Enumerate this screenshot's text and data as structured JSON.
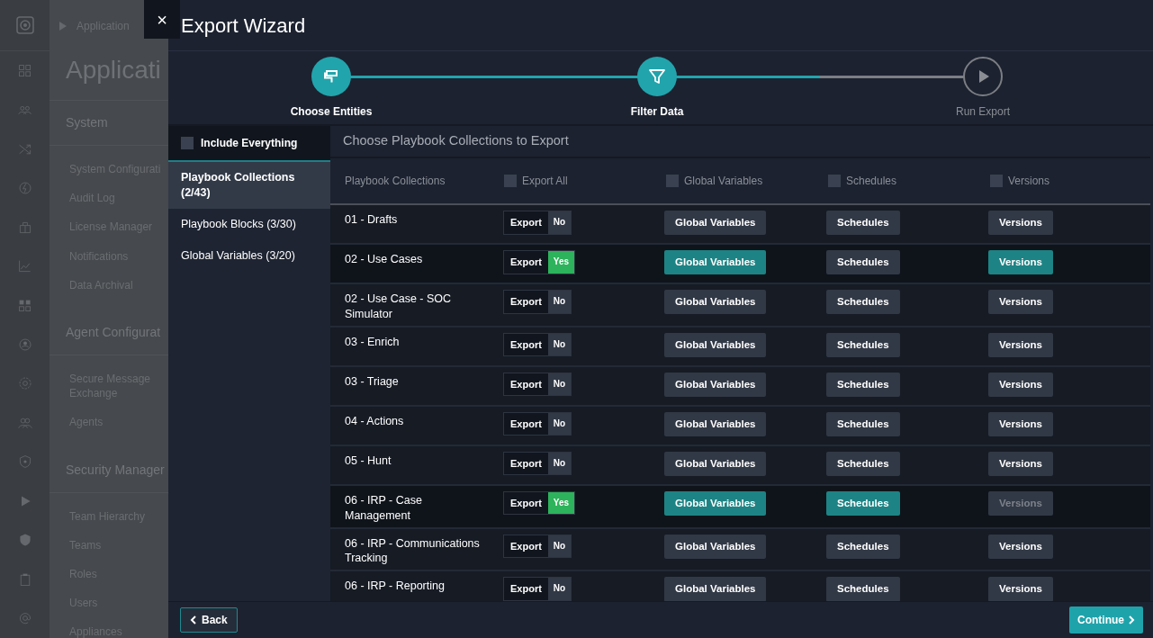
{
  "background_app": {
    "breadcrumb": "Application",
    "title": "Applicati",
    "sections": [
      {
        "heading": "System",
        "items": [
          "System Configurati",
          "Audit Log",
          "License Manager",
          "Notifications",
          "Data Archival"
        ]
      },
      {
        "heading": "Agent Configurat",
        "items": [
          "Secure Message Exchange",
          "Agents"
        ]
      },
      {
        "heading": "Security Manager",
        "items": [
          "Team Hierarchy",
          "Teams",
          "Roles",
          "Users",
          "Appliances"
        ]
      }
    ]
  },
  "wizard": {
    "title": "Export Wizard",
    "close": "×",
    "steps": [
      {
        "label": "Choose Entities",
        "reached": true
      },
      {
        "label": "Filter Data",
        "reached": true
      },
      {
        "label": "Run Export",
        "reached": false
      }
    ],
    "include_everything": {
      "label": "Include Everything",
      "checked": false
    },
    "nav": [
      {
        "label": "Playbook Collections (2/43)",
        "selected": true
      },
      {
        "label": "Playbook Blocks (3/30)",
        "selected": false
      },
      {
        "label": "Global Variables (3/20)",
        "selected": false
      }
    ],
    "heading": "Choose Playbook Collections to Export",
    "columns": [
      {
        "label": "Playbook Collections"
      },
      {
        "label": "Export All",
        "checked": false
      },
      {
        "label": "Global Variables",
        "checked": false
      },
      {
        "label": "Schedules",
        "checked": false
      },
      {
        "label": "Versions",
        "checked": false
      }
    ],
    "rows": [
      {
        "name": "01 - Drafts",
        "export_label": "Export",
        "export": false,
        "export_value": "No",
        "buttons": [
          {
            "label": "Global Variables",
            "selected": false,
            "disabled": false
          },
          {
            "label": "Schedules",
            "selected": false,
            "disabled": false
          },
          {
            "label": "Versions",
            "selected": false,
            "disabled": false
          }
        ]
      },
      {
        "name": "02 - Use Cases",
        "export_label": "Export",
        "export": true,
        "export_value": "Yes",
        "buttons": [
          {
            "label": "Global Variables",
            "selected": true,
            "disabled": false
          },
          {
            "label": "Schedules",
            "selected": false,
            "disabled": false
          },
          {
            "label": "Versions",
            "selected": true,
            "disabled": false
          }
        ]
      },
      {
        "name": "02 - Use Case - SOC Simulator",
        "export_label": "Export",
        "export": false,
        "export_value": "No",
        "buttons": [
          {
            "label": "Global Variables",
            "selected": false,
            "disabled": false
          },
          {
            "label": "Schedules",
            "selected": false,
            "disabled": false
          },
          {
            "label": "Versions",
            "selected": false,
            "disabled": false
          }
        ]
      },
      {
        "name": "03 - Enrich",
        "export_label": "Export",
        "export": false,
        "export_value": "No",
        "buttons": [
          {
            "label": "Global Variables",
            "selected": false,
            "disabled": false
          },
          {
            "label": "Schedules",
            "selected": false,
            "disabled": false
          },
          {
            "label": "Versions",
            "selected": false,
            "disabled": false
          }
        ]
      },
      {
        "name": "03 - Triage",
        "export_label": "Export",
        "export": false,
        "export_value": "No",
        "buttons": [
          {
            "label": "Global Variables",
            "selected": false,
            "disabled": false
          },
          {
            "label": "Schedules",
            "selected": false,
            "disabled": false
          },
          {
            "label": "Versions",
            "selected": false,
            "disabled": false
          }
        ]
      },
      {
        "name": "04 - Actions",
        "export_label": "Export",
        "export": false,
        "export_value": "No",
        "buttons": [
          {
            "label": "Global Variables",
            "selected": false,
            "disabled": false
          },
          {
            "label": "Schedules",
            "selected": false,
            "disabled": false
          },
          {
            "label": "Versions",
            "selected": false,
            "disabled": false
          }
        ]
      },
      {
        "name": "05 - Hunt",
        "export_label": "Export",
        "export": false,
        "export_value": "No",
        "buttons": [
          {
            "label": "Global Variables",
            "selected": false,
            "disabled": false
          },
          {
            "label": "Schedules",
            "selected": false,
            "disabled": false
          },
          {
            "label": "Versions",
            "selected": false,
            "disabled": false
          }
        ]
      },
      {
        "name": "06 - IRP - Case Management",
        "export_label": "Export",
        "export": true,
        "export_value": "Yes",
        "buttons": [
          {
            "label": "Global Variables",
            "selected": true,
            "disabled": false
          },
          {
            "label": "Schedules",
            "selected": true,
            "disabled": false
          },
          {
            "label": "Versions",
            "selected": false,
            "disabled": true
          }
        ]
      },
      {
        "name": "06 - IRP - Communications Tracking",
        "export_label": "Export",
        "export": false,
        "export_value": "No",
        "buttons": [
          {
            "label": "Global Variables",
            "selected": false,
            "disabled": false
          },
          {
            "label": "Schedules",
            "selected": false,
            "disabled": false
          },
          {
            "label": "Versions",
            "selected": false,
            "disabled": false
          }
        ]
      },
      {
        "name": "06 - IRP - Reporting",
        "export_label": "Export",
        "export": false,
        "export_value": "No",
        "buttons": [
          {
            "label": "Global Variables",
            "selected": false,
            "disabled": false
          },
          {
            "label": "Schedules",
            "selected": false,
            "disabled": false
          },
          {
            "label": "Versions",
            "selected": false,
            "disabled": false
          }
        ]
      }
    ],
    "back": "Back",
    "continue": "Continue"
  }
}
